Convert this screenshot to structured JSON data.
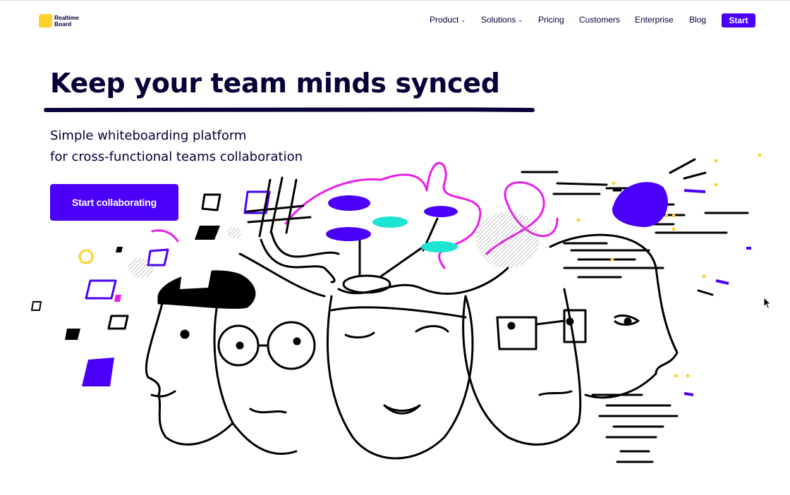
{
  "brand": {
    "line1": "Realtime",
    "line2": "Board",
    "color": "#ffd02f"
  },
  "nav": {
    "items": [
      {
        "label": "Product",
        "has_dropdown": true
      },
      {
        "label": "Solutions",
        "has_dropdown": true
      },
      {
        "label": "Pricing",
        "has_dropdown": false
      },
      {
        "label": "Customers",
        "has_dropdown": false
      },
      {
        "label": "Enterprise",
        "has_dropdown": false
      },
      {
        "label": "Blog",
        "has_dropdown": false
      }
    ],
    "start_label": "Start"
  },
  "hero": {
    "title": "Keep your team minds synced",
    "subtitle_line1": "Simple whiteboarding platform",
    "subtitle_line2": "for cross-functional teams collaboration",
    "cta_label": "Start collaborating"
  },
  "colors": {
    "accent": "#4a00f8",
    "text": "#050038",
    "magenta": "#e91ee9",
    "teal": "#1de4d0",
    "yellow": "#ffd02f"
  },
  "icons": {
    "dropdown": "chevron-down-icon",
    "cursor": "mouse-cursor-icon"
  }
}
